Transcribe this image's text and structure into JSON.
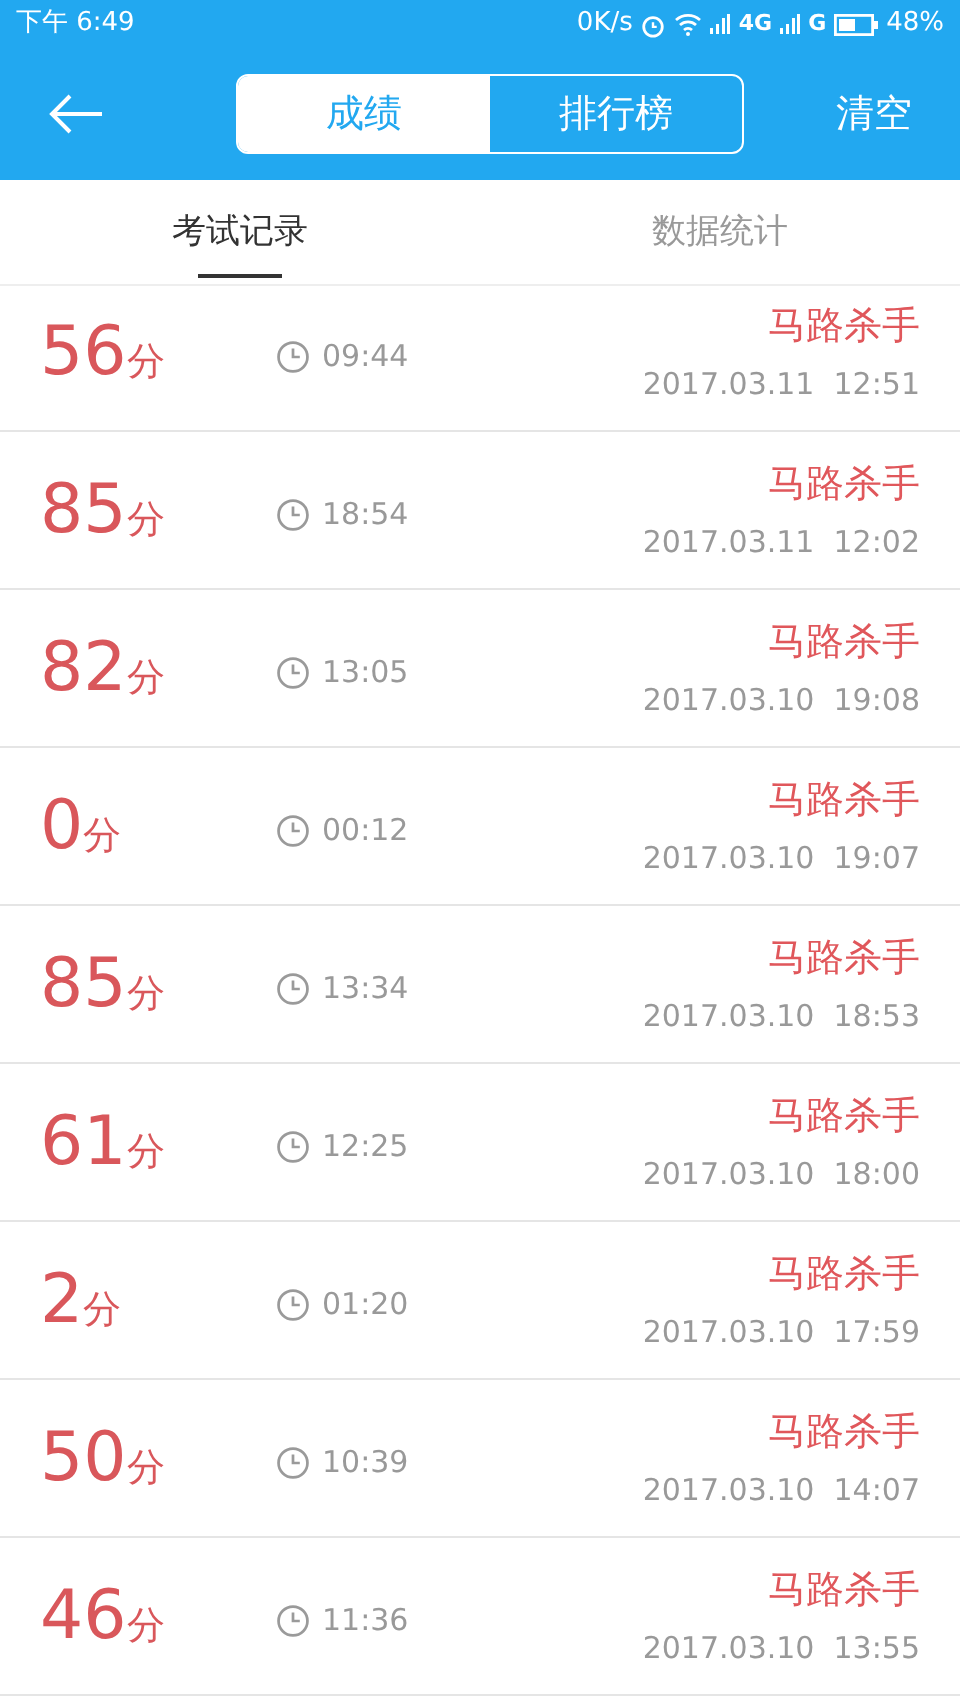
{
  "status_bar": {
    "time": "下午 6:49",
    "speed": "0K/s",
    "network_1": "4G",
    "network_2": "G",
    "battery": "48%"
  },
  "header": {
    "segments": [
      {
        "label": "成绩",
        "selected": true
      },
      {
        "label": "排行榜",
        "selected": false
      }
    ],
    "action": "清空"
  },
  "tabs": [
    {
      "label": "考试记录",
      "selected": true
    },
    {
      "label": "数据统计",
      "selected": false
    }
  ],
  "records": [
    {
      "score": "56",
      "unit": "分",
      "duration": "09:44",
      "title": "马路杀手",
      "date": "2017.03.11  12:51"
    },
    {
      "score": "85",
      "unit": "分",
      "duration": "18:54",
      "title": "马路杀手",
      "date": "2017.03.11  12:02"
    },
    {
      "score": "82",
      "unit": "分",
      "duration": "13:05",
      "title": "马路杀手",
      "date": "2017.03.10  19:08"
    },
    {
      "score": "0",
      "unit": "分",
      "duration": "00:12",
      "title": "马路杀手",
      "date": "2017.03.10  19:07"
    },
    {
      "score": "85",
      "unit": "分",
      "duration": "13:34",
      "title": "马路杀手",
      "date": "2017.03.10  18:53"
    },
    {
      "score": "61",
      "unit": "分",
      "duration": "12:25",
      "title": "马路杀手",
      "date": "2017.03.10  18:00"
    },
    {
      "score": "2",
      "unit": "分",
      "duration": "01:20",
      "title": "马路杀手",
      "date": "2017.03.10  17:59"
    },
    {
      "score": "50",
      "unit": "分",
      "duration": "10:39",
      "title": "马路杀手",
      "date": "2017.03.10  14:07"
    },
    {
      "score": "46",
      "unit": "分",
      "duration": "11:36",
      "title": "马路杀手",
      "date": "2017.03.10  13:55"
    }
  ]
}
